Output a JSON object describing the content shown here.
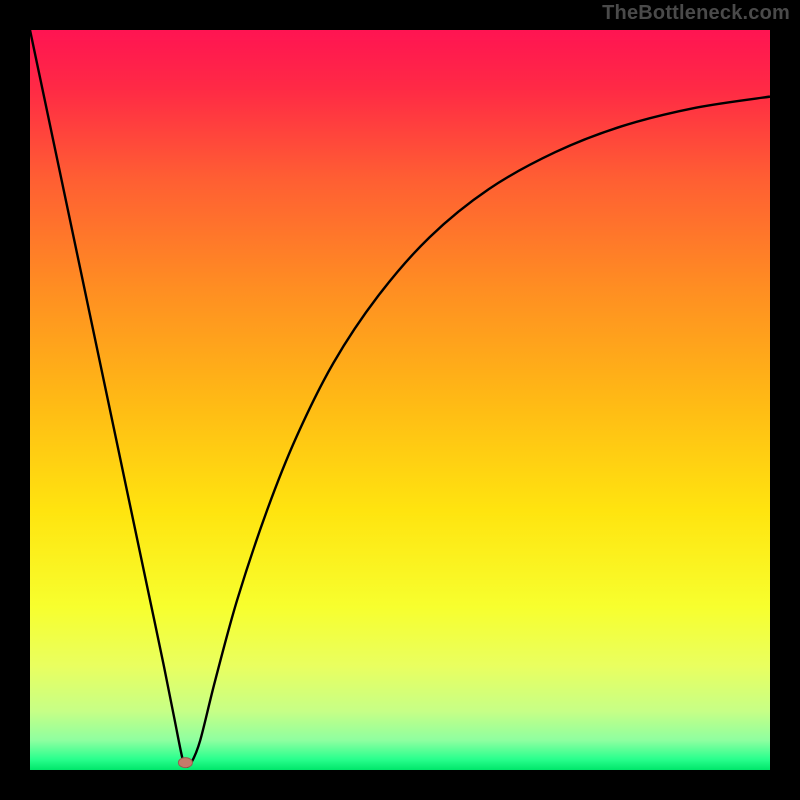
{
  "watermark": "TheBottleneck.com",
  "colors": {
    "frame": "#000000",
    "curve": "#000000",
    "marker_fill": "#c47b6a",
    "marker_stroke": "#9a5c50",
    "gradient_stops": [
      {
        "offset": 0.0,
        "color": "#ff1452"
      },
      {
        "offset": 0.08,
        "color": "#ff2a45"
      },
      {
        "offset": 0.2,
        "color": "#ff5e33"
      },
      {
        "offset": 0.35,
        "color": "#ff8e22"
      },
      {
        "offset": 0.5,
        "color": "#ffb915"
      },
      {
        "offset": 0.65,
        "color": "#ffe40f"
      },
      {
        "offset": 0.78,
        "color": "#f7ff2e"
      },
      {
        "offset": 0.86,
        "color": "#e9ff60"
      },
      {
        "offset": 0.92,
        "color": "#c7ff86"
      },
      {
        "offset": 0.96,
        "color": "#8effa0"
      },
      {
        "offset": 0.985,
        "color": "#2bff8e"
      },
      {
        "offset": 1.0,
        "color": "#00e66a"
      }
    ]
  },
  "chart_data": {
    "type": "line",
    "title": "",
    "xlabel": "",
    "ylabel": "",
    "xlim": [
      0,
      100
    ],
    "ylim": [
      0,
      100
    ],
    "marker": {
      "x": 21,
      "y": 1.0
    },
    "series": [
      {
        "name": "bottleneck-curve",
        "points": [
          {
            "x": 0.0,
            "y": 100.0
          },
          {
            "x": 2.0,
            "y": 90.5
          },
          {
            "x": 4.0,
            "y": 81.0
          },
          {
            "x": 6.0,
            "y": 71.5
          },
          {
            "x": 8.0,
            "y": 62.0
          },
          {
            "x": 10.0,
            "y": 52.5
          },
          {
            "x": 12.0,
            "y": 43.0
          },
          {
            "x": 14.0,
            "y": 33.5
          },
          {
            "x": 16.0,
            "y": 24.0
          },
          {
            "x": 18.0,
            "y": 14.5
          },
          {
            "x": 19.5,
            "y": 7.0
          },
          {
            "x": 20.5,
            "y": 2.0
          },
          {
            "x": 21.0,
            "y": 0.5
          },
          {
            "x": 21.8,
            "y": 1.0
          },
          {
            "x": 23.0,
            "y": 4.0
          },
          {
            "x": 25.0,
            "y": 12.0
          },
          {
            "x": 28.0,
            "y": 23.0
          },
          {
            "x": 32.0,
            "y": 35.0
          },
          {
            "x": 36.0,
            "y": 45.0
          },
          {
            "x": 41.0,
            "y": 55.0
          },
          {
            "x": 47.0,
            "y": 64.0
          },
          {
            "x": 54.0,
            "y": 72.0
          },
          {
            "x": 62.0,
            "y": 78.5
          },
          {
            "x": 71.0,
            "y": 83.5
          },
          {
            "x": 80.0,
            "y": 87.0
          },
          {
            "x": 90.0,
            "y": 89.5
          },
          {
            "x": 100.0,
            "y": 91.0
          }
        ]
      }
    ]
  }
}
